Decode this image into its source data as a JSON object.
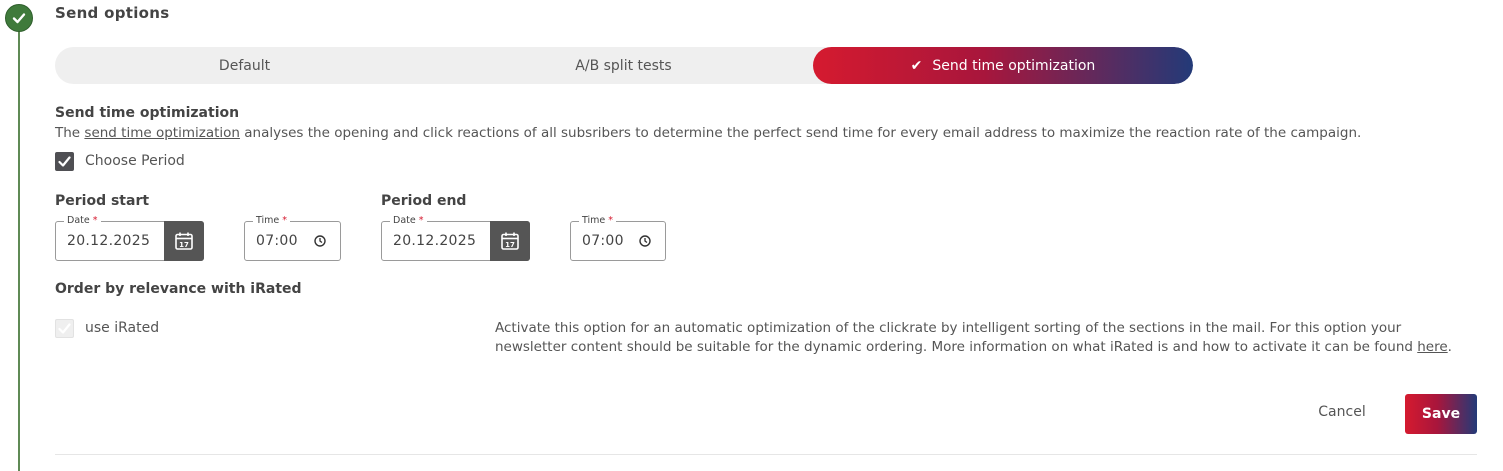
{
  "section": {
    "title": "Send options"
  },
  "tabs": [
    {
      "label": "Default",
      "active": false
    },
    {
      "label": "A/B split tests",
      "active": false
    },
    {
      "label": "Send time optimization",
      "active": true
    }
  ],
  "sto": {
    "heading": "Send time optimization",
    "desc_prefix": "The ",
    "desc_link": "send time optimization",
    "desc_suffix": " analyses the opening and click reactions of all subsribers to determine the perfect send time for every email address to maximize the reaction rate of the campaign.",
    "choose_period_label": "Choose Period",
    "choose_period_checked": true
  },
  "period_start": {
    "heading": "Period start",
    "date_label": "Date",
    "date_value": "20.12.2025",
    "time_label": "Time",
    "time_value": "07:00"
  },
  "period_end": {
    "heading": "Period end",
    "date_label": "Date",
    "date_value": "20.12.2025",
    "time_label": "Time",
    "time_value": "07:00"
  },
  "irated": {
    "heading": "Order by relevance with iRated",
    "checkbox_label": "use iRated",
    "checked": true,
    "disabled": true,
    "desc": "Activate this option for an automatic optimization of the clickrate by intelligent sorting of the sections in the mail. For this option your newsletter content should be suitable for the dynamic ordering. More information on what iRated is and how to activate it can be found ",
    "desc_link": "here",
    "desc_end": "."
  },
  "actions": {
    "cancel": "Cancel",
    "save": "Save"
  },
  "colors": {
    "step_done": "#3f7a3b",
    "accent_start": "#d51a2f",
    "accent_end": "#233a78",
    "required": "#d51a2f"
  },
  "icons": {
    "step": "check-icon",
    "calendar": "calendar-icon",
    "clock": "clock-icon"
  }
}
